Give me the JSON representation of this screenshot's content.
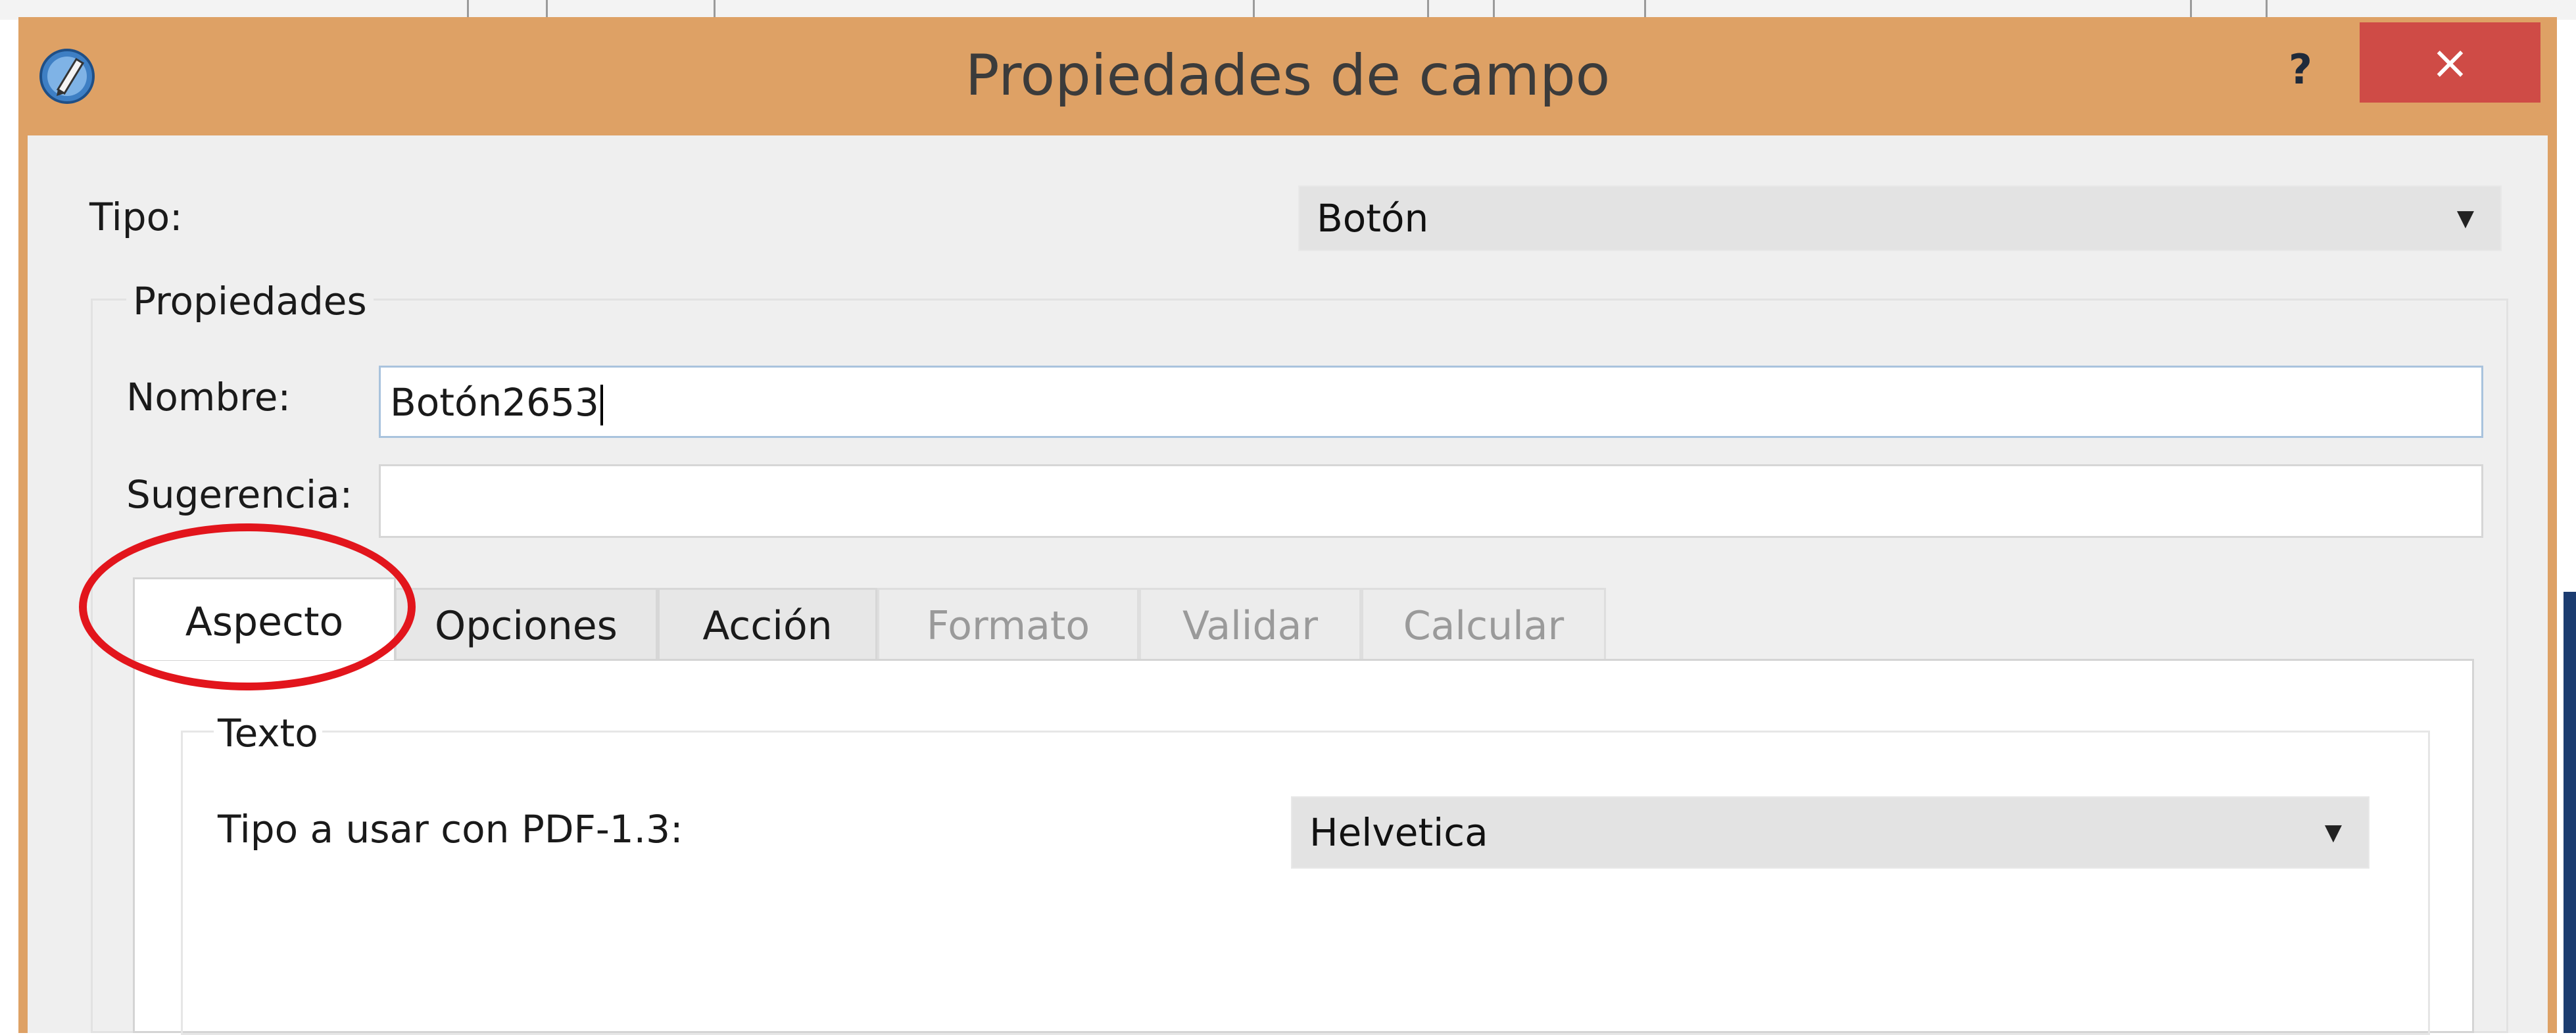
{
  "window": {
    "title": "Propiedades de campo",
    "help_label": "?",
    "close_label": "×",
    "title_bar_color": "#dea165",
    "close_button_color": "#cf4b46",
    "app_icon": "pencil-icon"
  },
  "tipo": {
    "label": "Tipo:",
    "value": "Botón"
  },
  "propiedades": {
    "group_label": "Propiedades",
    "nombre_label": "Nombre:",
    "nombre_value": "Botón2653",
    "sugerencia_label": "Sugerencia:",
    "sugerencia_value": ""
  },
  "tabs": [
    {
      "label": "Aspecto",
      "state": "selected"
    },
    {
      "label": "Opciones",
      "state": "enabled"
    },
    {
      "label": "Acción",
      "state": "enabled"
    },
    {
      "label": "Formato",
      "state": "disabled"
    },
    {
      "label": "Validar",
      "state": "disabled"
    },
    {
      "label": "Calcular",
      "state": "disabled"
    }
  ],
  "aspecto": {
    "texto_group_label": "Texto",
    "font_label": "Tipo a usar con PDF-1.3:",
    "font_value": "Helvetica"
  },
  "annotation": {
    "kind": "red-circle-highlight",
    "target": "Aspecto",
    "color": "#e2151c"
  }
}
